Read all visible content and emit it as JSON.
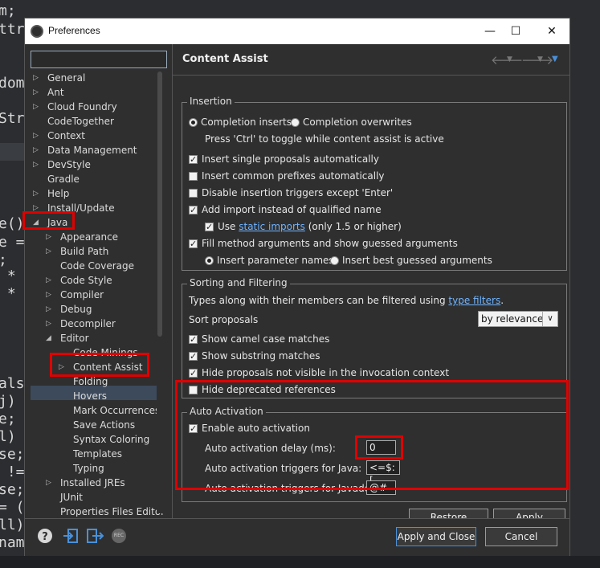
{
  "background_code": {
    "lines": [
      "m;",
      "ttr",
      "dom",
      "Str",
      "e()",
      "e =",
      ";",
      " *",
      " *",
      "als",
      "j)",
      "e;",
      "l)",
      "se;",
      " !=",
      "se;",
      "= (",
      "ll)",
      "nam"
    ]
  },
  "dialog": {
    "title": "Preferences",
    "window_buttons": {
      "minimize": "—",
      "maximize": "☐",
      "close": "✕"
    }
  },
  "filter": {
    "value": ""
  },
  "tree": {
    "items": [
      {
        "label": "General",
        "expandable": true
      },
      {
        "label": "Ant",
        "expandable": true
      },
      {
        "label": "Cloud Foundry",
        "expandable": true
      },
      {
        "label": "CodeTogether",
        "expandable": false
      },
      {
        "label": "Context",
        "expandable": true
      },
      {
        "label": "Data Management",
        "expandable": true
      },
      {
        "label": "DevStyle",
        "expandable": true
      },
      {
        "label": "Gradle",
        "expandable": false
      },
      {
        "label": "Help",
        "expandable": true
      },
      {
        "label": "Install/Update",
        "expandable": true
      },
      {
        "label": "Java",
        "expandable": true,
        "expanded": true
      },
      {
        "label": "Appearance",
        "expandable": true
      },
      {
        "label": "Build Path",
        "expandable": true
      },
      {
        "label": "Code Coverage",
        "expandable": false
      },
      {
        "label": "Code Style",
        "expandable": true
      },
      {
        "label": "Compiler",
        "expandable": true
      },
      {
        "label": "Debug",
        "expandable": true
      },
      {
        "label": "Decompiler",
        "expandable": true
      },
      {
        "label": "Editor",
        "expandable": true,
        "expanded": true
      },
      {
        "label": "Code Minings",
        "expandable": false
      },
      {
        "label": "Content Assist",
        "expandable": true,
        "selected": true
      },
      {
        "label": "Folding",
        "expandable": false
      },
      {
        "label": "Hovers",
        "expandable": false
      },
      {
        "label": "Mark Occurrences",
        "expandable": false
      },
      {
        "label": "Save Actions",
        "expandable": false
      },
      {
        "label": "Syntax Coloring",
        "expandable": false
      },
      {
        "label": "Templates",
        "expandable": false
      },
      {
        "label": "Typing",
        "expandable": false
      },
      {
        "label": "Installed JREs",
        "expandable": true
      },
      {
        "label": "JUnit",
        "expandable": false
      },
      {
        "label": "Properties Files Editor",
        "expandable": false
      }
    ]
  },
  "page": {
    "title": "Content Assist",
    "insertion": {
      "legend": "Insertion",
      "completion_inserts": "Completion inserts",
      "completion_overwrites": "Completion overwrites",
      "toggle_hint": "Press 'Ctrl' to toggle while content assist is active",
      "insert_single": "Insert single proposals automatically",
      "insert_prefixes": "Insert common prefixes automatically",
      "disable_triggers": "Disable insertion triggers except 'Enter'",
      "add_import": "Add import instead of qualified name",
      "use_prefix": "Use",
      "static_imports_link": "static imports",
      "use_suffix": "(only 1.5 or higher)",
      "fill_args": "Fill method arguments and show guessed arguments",
      "insert_param_names": "Insert parameter names",
      "insert_best_guessed": "Insert best guessed arguments"
    },
    "sorting": {
      "legend": "Sorting and Filtering",
      "types_text": "Types along with their members can be filtered using",
      "type_filters_link": "type filters",
      "types_period": ".",
      "sort_label": "Sort proposals",
      "sort_value": "by relevance",
      "show_camel": "Show camel case matches",
      "show_substring": "Show substring matches",
      "hide_not_visible": "Hide proposals not visible in the invocation context",
      "hide_deprecated": "Hide deprecated references"
    },
    "auto_activation": {
      "legend": "Auto Activation",
      "enable": "Enable auto activation",
      "delay_label": "Auto activation delay (ms):",
      "delay_value": "0",
      "java_label": "Auto activation triggers for Java:",
      "java_value": "<=$:[.",
      "javadoc_label": "Auto activation triggers for Javadoc:",
      "javadoc_value": "@#"
    },
    "restore_defaults": "Restore Defaults",
    "apply": "Apply"
  },
  "footer": {
    "apply_and_close": "Apply and Close",
    "cancel": "Cancel",
    "rec_label": "REC"
  },
  "colors": {
    "highlight": "#e00000",
    "link": "#6fb3ff",
    "default_button_border": "#4a90d9"
  }
}
